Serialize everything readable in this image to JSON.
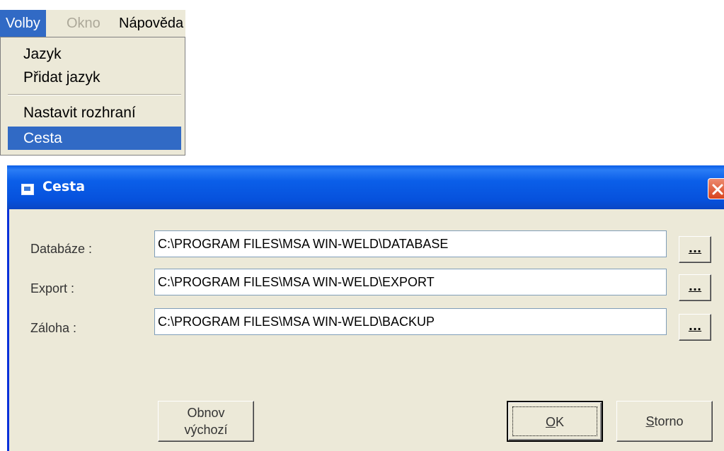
{
  "menu": {
    "items": [
      {
        "label": "Volby",
        "state": "active"
      },
      {
        "label": "Okno",
        "state": "disabled"
      },
      {
        "label": "Nápověda",
        "state": "normal"
      }
    ],
    "dropdown": [
      {
        "label": "Jazyk"
      },
      {
        "label": "Přidat jazyk"
      },
      {
        "label": "Nastavit rozhraní"
      },
      {
        "label": "Cesta",
        "selected": true
      }
    ]
  },
  "dialog": {
    "title": "Cesta",
    "fields": [
      {
        "label": "Databáze :",
        "value": "C:\\PROGRAM FILES\\MSA WIN-WELD\\DATABASE",
        "browse_label": "..."
      },
      {
        "label": "Export :",
        "value": "C:\\PROGRAM FILES\\MSA WIN-WELD\\EXPORT",
        "browse_label": "..."
      },
      {
        "label": "Záloha :",
        "value": "C:\\PROGRAM FILES\\MSA WIN-WELD\\BACKUP",
        "browse_label": "..."
      }
    ],
    "buttons": {
      "reset_line1": "Obnov",
      "reset_line2": "výchozí",
      "ok_mnemonic": "O",
      "ok_rest": "K",
      "storno_mnemonic": "S",
      "storno_rest": "torno"
    }
  },
  "colors": {
    "selection": "#316ac5",
    "titlebar": "#0a5ee8",
    "face": "#ece9d8"
  }
}
